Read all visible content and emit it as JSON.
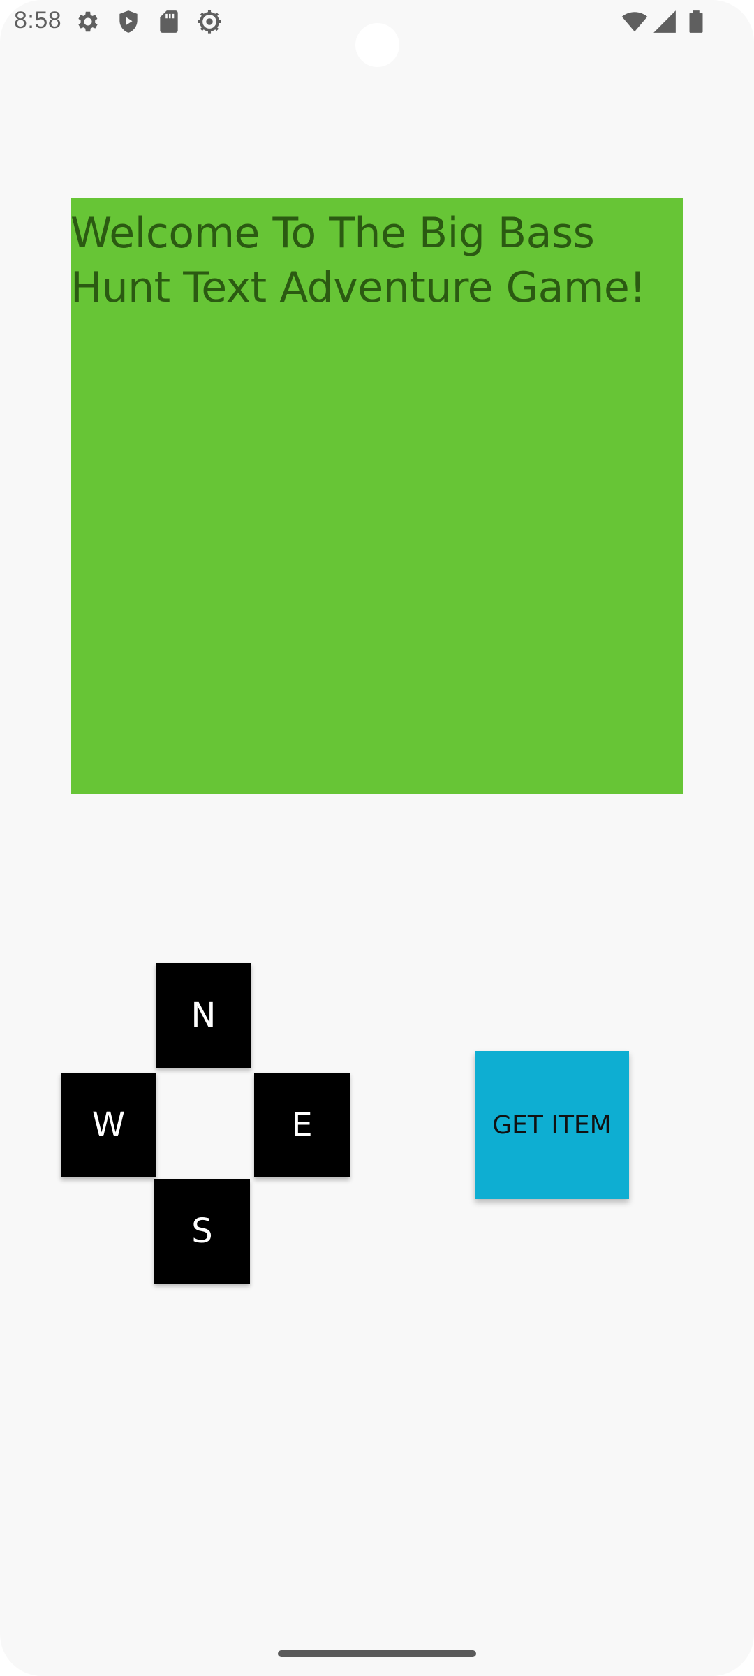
{
  "status_bar": {
    "time": "8:58",
    "left_icons": [
      "settings-icon",
      "shield-play-icon",
      "sd-card-icon",
      "debug-gear-icon"
    ],
    "right_icons": [
      "wifi-icon",
      "cellular-signal-icon",
      "battery-icon"
    ]
  },
  "game": {
    "message": "Welcome To The Big Bass Hunt Text Adventure Game!",
    "panel_color": "#67c536"
  },
  "controls": {
    "north_label": "N",
    "west_label": "W",
    "east_label": "E",
    "south_label": "S",
    "get_item_label": "GET ITEM",
    "get_item_color": "#0eaed2"
  }
}
